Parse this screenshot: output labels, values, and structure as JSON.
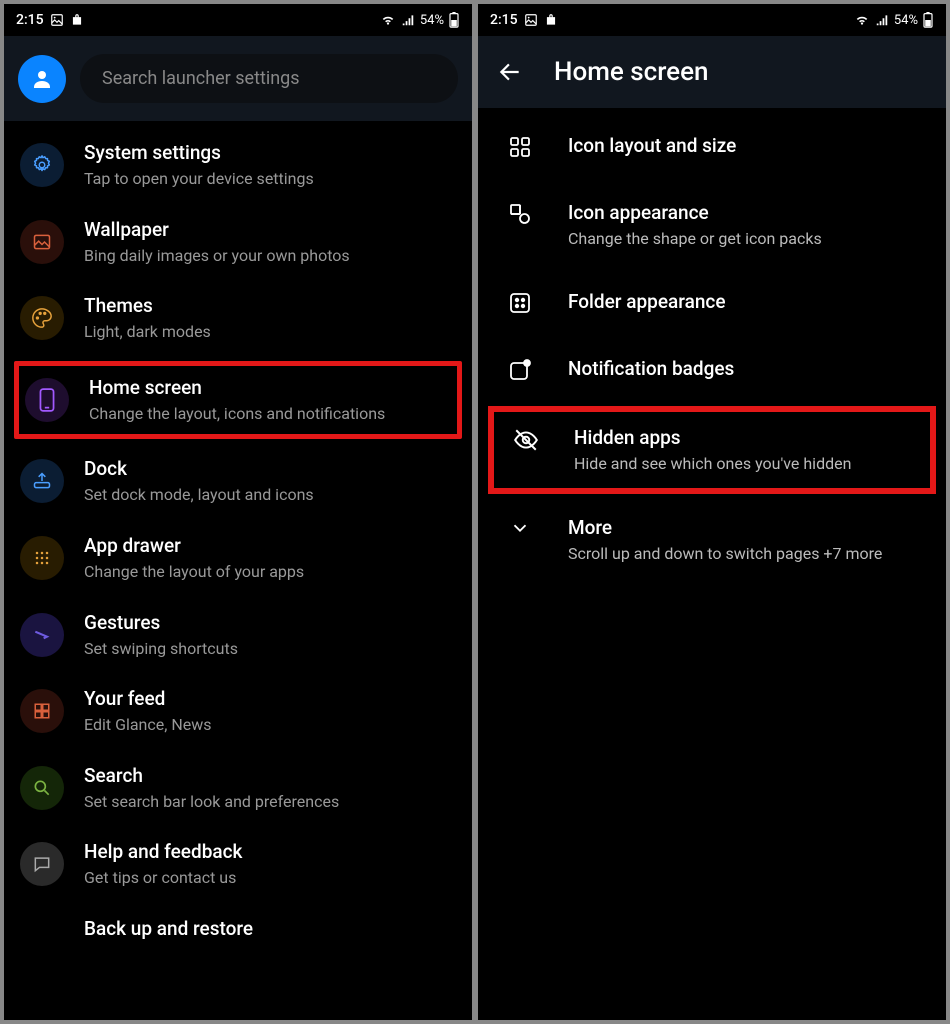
{
  "status": {
    "time": "2:15",
    "battery": "54%"
  },
  "left": {
    "search_placeholder": "Search launcher settings",
    "items": [
      {
        "title": "System settings",
        "sub": "Tap to open your device settings"
      },
      {
        "title": "Wallpaper",
        "sub": "Bing daily images or your own photos"
      },
      {
        "title": "Themes",
        "sub": "Light, dark modes"
      },
      {
        "title": "Home screen",
        "sub": "Change the layout, icons and notifications"
      },
      {
        "title": "Dock",
        "sub": "Set dock mode, layout and icons"
      },
      {
        "title": "App drawer",
        "sub": "Change the layout of your apps"
      },
      {
        "title": "Gestures",
        "sub": "Set swiping shortcuts"
      },
      {
        "title": "Your feed",
        "sub": "Edit Glance, News"
      },
      {
        "title": "Search",
        "sub": "Set search bar look and preferences"
      },
      {
        "title": "Help and feedback",
        "sub": "Get tips or contact us"
      },
      {
        "title": "Back up and restore",
        "sub": ""
      }
    ]
  },
  "right": {
    "title": "Home screen",
    "items": [
      {
        "title": "Icon layout and size",
        "sub": ""
      },
      {
        "title": "Icon appearance",
        "sub": "Change the shape or get icon packs"
      },
      {
        "title": "Folder appearance",
        "sub": ""
      },
      {
        "title": "Notification badges",
        "sub": ""
      },
      {
        "title": "Hidden apps",
        "sub": "Hide and see which ones you've hidden"
      },
      {
        "title": "More",
        "sub": "Scroll up and down to switch pages +7 more"
      }
    ]
  }
}
